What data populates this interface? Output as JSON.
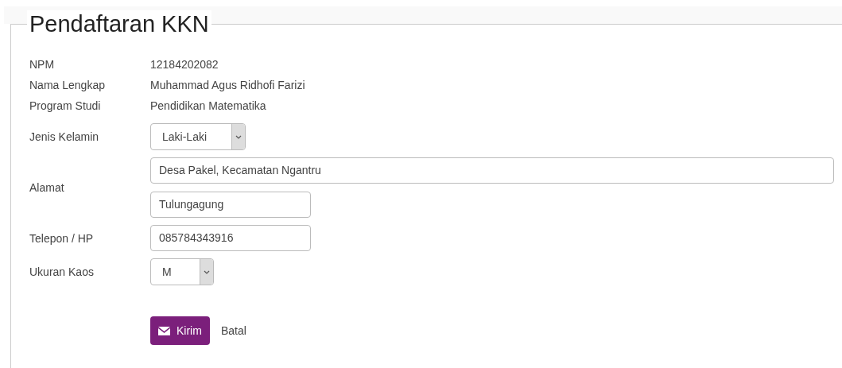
{
  "title": "Pendaftaran KKN",
  "info": [
    {
      "label": "NPM",
      "value": "12184202082"
    },
    {
      "label": "Nama Lengkap",
      "value": "Muhammad Agus Ridhofi Farizi"
    },
    {
      "label": "Program Studi",
      "value": "Pendidikan Matematika"
    }
  ],
  "fields": [
    {
      "label": "Jenis Kelamin",
      "kind": "select",
      "values": [
        "Laki-Laki"
      ]
    },
    {
      "label": "Alamat",
      "kind": "inputs",
      "values": [
        "Desa Pakel, Kecamatan Ngantru",
        "Tulungagung"
      ]
    },
    {
      "label": "Telepon / HP",
      "kind": "input",
      "values": [
        "085784343916"
      ]
    },
    {
      "label": "Ukuran Kaos",
      "kind": "select-small",
      "values": [
        "M"
      ]
    }
  ],
  "submit": "Kirim",
  "cancel": "Batal"
}
